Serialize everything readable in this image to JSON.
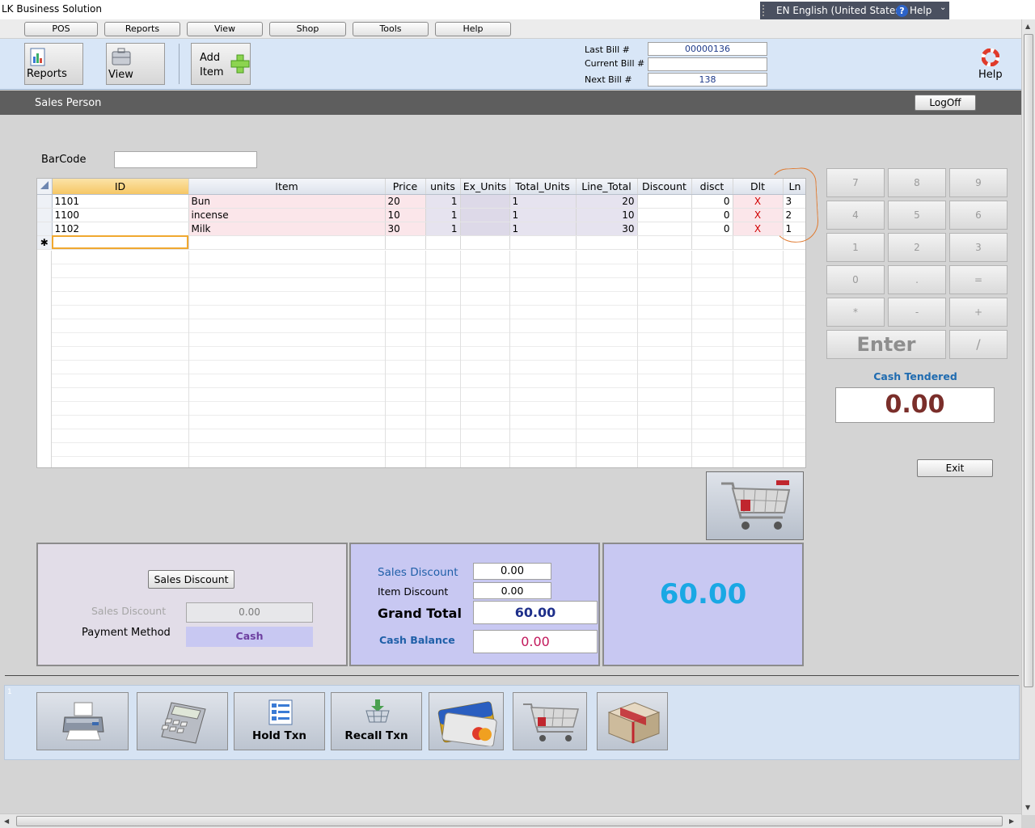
{
  "window": {
    "title": "LK Business Solution"
  },
  "language_bar": {
    "language": "EN English (United States)",
    "help": "Help",
    "help_glyph": "?"
  },
  "menu": {
    "items": [
      "POS",
      "Reports",
      "View",
      "Shop",
      "Tools",
      "Help"
    ]
  },
  "toolbar": {
    "reports_label": "Reports",
    "view_label": "View",
    "add_item_label_1": "Add",
    "add_item_label_2": "Item",
    "help_label": "Help"
  },
  "bills": {
    "last_label": "Last Bill #",
    "last_value": "00000136",
    "current_label": "Current Bill #",
    "current_value": "",
    "next_label": "Next  Bill #",
    "next_value": "138"
  },
  "sales_person": {
    "label": "Sales Person",
    "logoff_label": "LogOff"
  },
  "barcode": {
    "label": "BarCode",
    "value": ""
  },
  "grid": {
    "columns": [
      "ID",
      "Item",
      "Price",
      "units",
      "Ex_Units",
      "Total_Units",
      "Line_Total",
      "Discount",
      "disct",
      "Dlt",
      "Ln"
    ],
    "rows": [
      {
        "id": "1101",
        "item": "Bun",
        "price": "20",
        "units": "1",
        "ex_units": "",
        "total_units": "1",
        "line_total": "20",
        "discount": "",
        "disct": "0",
        "dlt": "X",
        "ln": "3"
      },
      {
        "id": "1100",
        "item": "incense",
        "price": "10",
        "units": "1",
        "ex_units": "",
        "total_units": "1",
        "line_total": "10",
        "discount": "",
        "disct": "0",
        "dlt": "X",
        "ln": "2"
      },
      {
        "id": "1102",
        "item": "Milk",
        "price": "30",
        "units": "1",
        "ex_units": "",
        "total_units": "1",
        "line_total": "30",
        "discount": "",
        "disct": "0",
        "dlt": "X",
        "ln": "1"
      }
    ],
    "new_row_marker": "✱"
  },
  "keypad": {
    "keys": [
      "7",
      "8",
      "9",
      "4",
      "5",
      "6",
      "1",
      "2",
      "3",
      "0",
      ".",
      "=",
      "*",
      "-",
      "+"
    ],
    "enter_label": "Enter",
    "divide_label": "/"
  },
  "cash_tendered": {
    "label": "Cash Tendered",
    "value": "0.00"
  },
  "exit_label": "Exit",
  "discount_panel": {
    "sales_discount_button": "Sales Discount",
    "sales_discount_label": "Sales Discount",
    "sales_discount_value": "0.00",
    "payment_method_label": "Payment Method",
    "payment_method_value": "Cash"
  },
  "totals_panel": {
    "sales_discount_label": "Sales Discount",
    "sales_discount_value": "0.00",
    "item_discount_label": "Item Discount",
    "item_discount_value": "0.00",
    "grand_total_label": "Grand Total",
    "grand_total_value": "60.00",
    "cash_balance_label": "Cash Balance",
    "cash_balance_value": "0.00"
  },
  "big_total": "60.00",
  "action_bar": {
    "index": "1",
    "hold_label": "Hold Txn",
    "recall_label": "Recall Txn"
  },
  "colors": {
    "accent_total": "#1aa8e4",
    "panel_lavender": "#c8c8f2",
    "delete_red": "#d00000"
  }
}
